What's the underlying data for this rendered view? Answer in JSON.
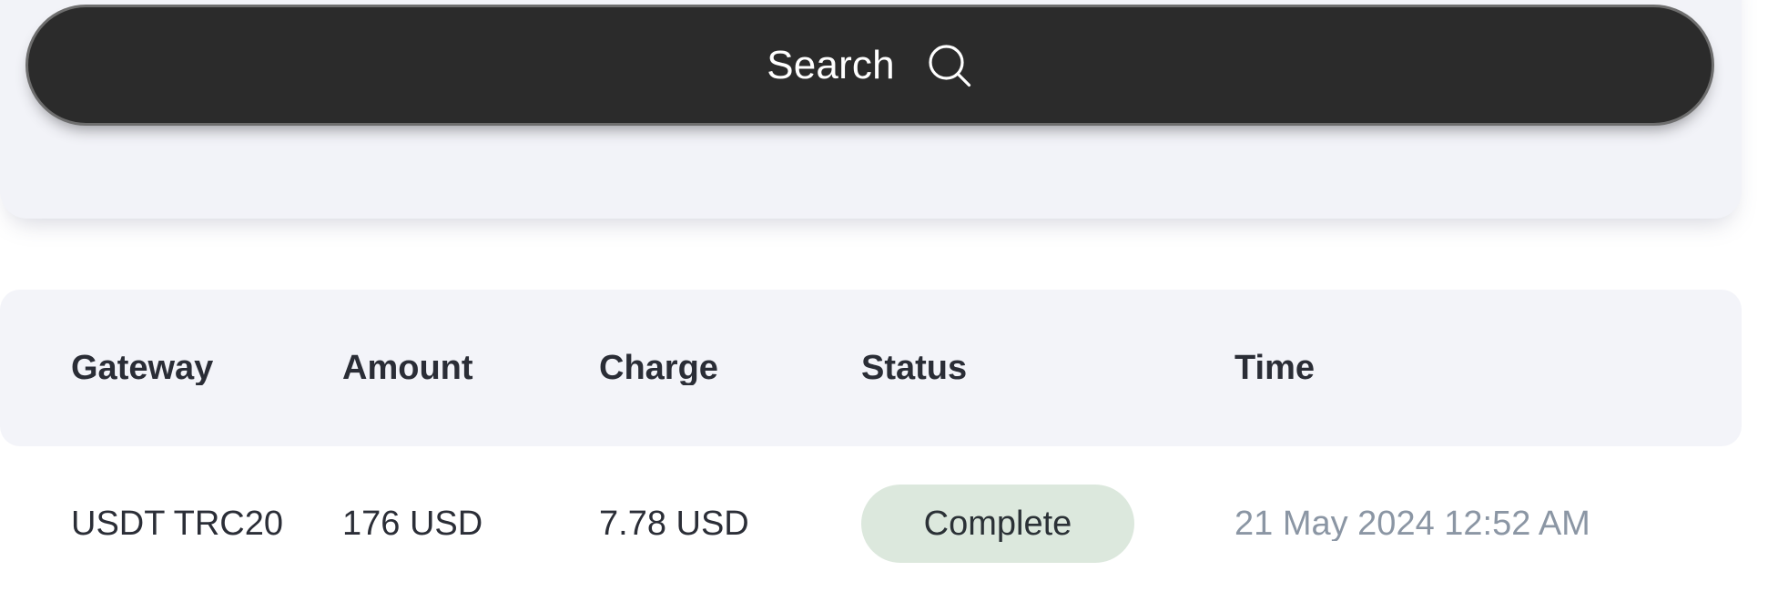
{
  "filter": {
    "input_value": "",
    "input_placeholder": ""
  },
  "search": {
    "label": "Search",
    "icon": "search-icon"
  },
  "table": {
    "columns": [
      "Gateway",
      "Amount",
      "Charge",
      "Status",
      "Time"
    ],
    "rows": [
      {
        "gateway": "USDT TRC20",
        "amount": "176 USD",
        "charge": "7.78 USD",
        "status": "Complete",
        "time": "21 May 2024 12:52 AM"
      }
    ]
  },
  "colors": {
    "button_bg": "#2b2b2b",
    "button_border": "#6e6e6e",
    "button_text": "#ffffff",
    "header_bg": "#f3f4f9",
    "header_text": "#2a2d36",
    "card_bg": "#f2f3f8",
    "status_complete_bg": "#dce8dd",
    "status_complete_text": "#2b3136",
    "time_text": "#8b96a4",
    "page_bg": "#ffffff"
  }
}
